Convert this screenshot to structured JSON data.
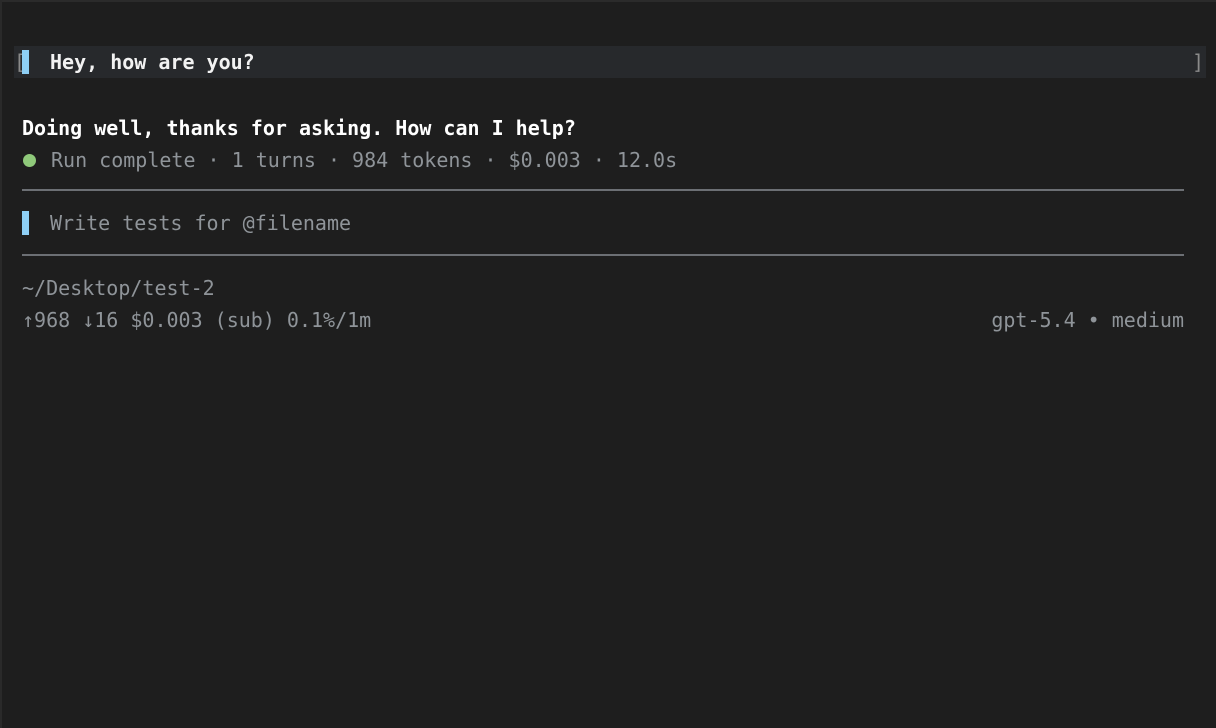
{
  "conversation": {
    "user_message": "Hey, how are you?",
    "assistant_message": "Doing well, thanks for asking. How can I help?",
    "status": "Run complete · 1 turns · 984 tokens · $0.003 · 12.0s"
  },
  "input": {
    "placeholder": "Write tests for @filename",
    "value": ""
  },
  "footer": {
    "cwd": "~/Desktop/test-2",
    "usage": "↑968 ↓16 $0.003 (sub) 0.1%/1m",
    "model": "gpt-5.4 • medium"
  },
  "icons": {
    "status_dot": "status-complete-dot"
  },
  "colors": {
    "background": "#1e1e1e",
    "accent": "#8ecff5",
    "status_ok": "#8fc97a",
    "muted_text": "#8f9499",
    "divider": "#6c6f74"
  }
}
